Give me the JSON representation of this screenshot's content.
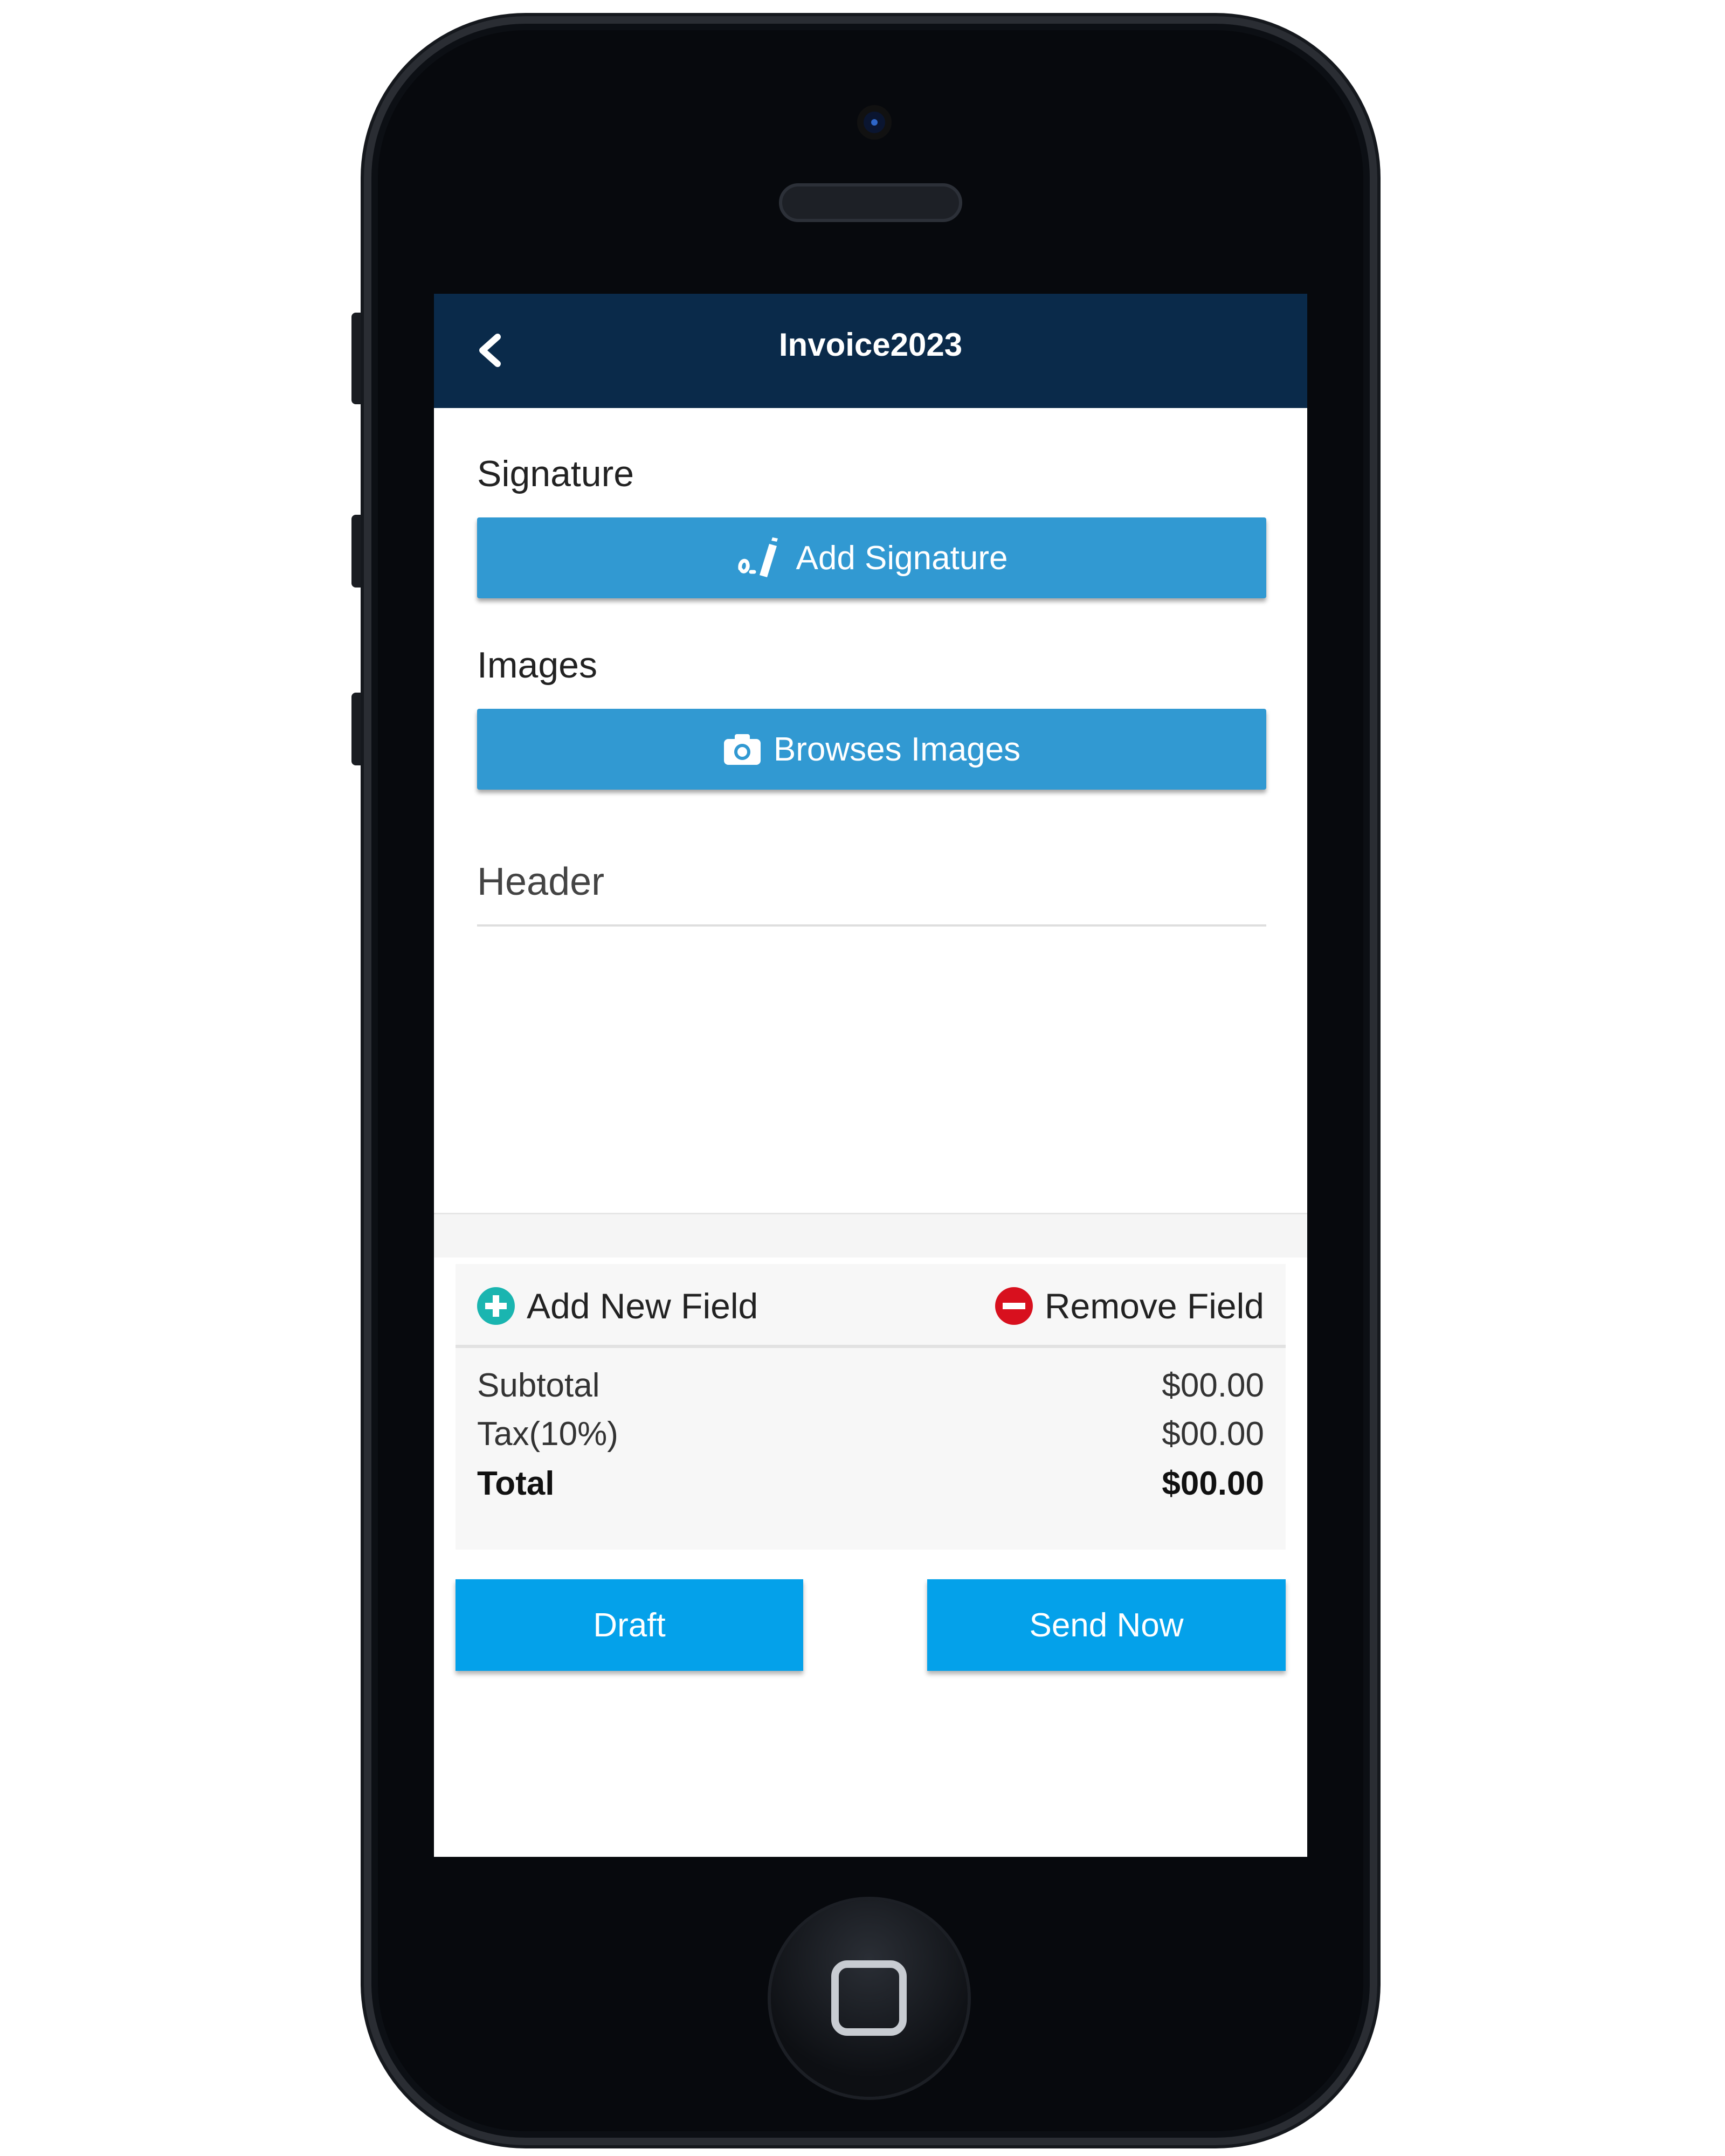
{
  "app": {
    "title": "Invoice2023"
  },
  "signature": {
    "label": "Signature",
    "button_label": "Add Signature"
  },
  "images": {
    "label": "Images",
    "button_label": "Browses Images"
  },
  "header_field": {
    "value": "Header"
  },
  "fields": {
    "add_label": "Add New Field",
    "remove_label": "Remove Field"
  },
  "summary": {
    "subtotal_label": "Subtotal",
    "subtotal_value": "$00.00",
    "tax_label": "Tax(10%)",
    "tax_value": "$00.00",
    "total_label": "Total",
    "total_value": "$00.00"
  },
  "actions": {
    "draft_label": "Draft",
    "send_label": "Send Now"
  },
  "colors": {
    "topbar": "#0a2a4a",
    "primary": "#3199d2",
    "action": "#04a1ea",
    "add": "#1ab5b0",
    "remove": "#d8101e"
  },
  "icons": {
    "back": "chevron-left-icon",
    "signature": "signature-icon",
    "camera": "camera-icon",
    "add": "plus-circle-icon",
    "remove": "minus-circle-icon",
    "home": "home-button-icon"
  }
}
